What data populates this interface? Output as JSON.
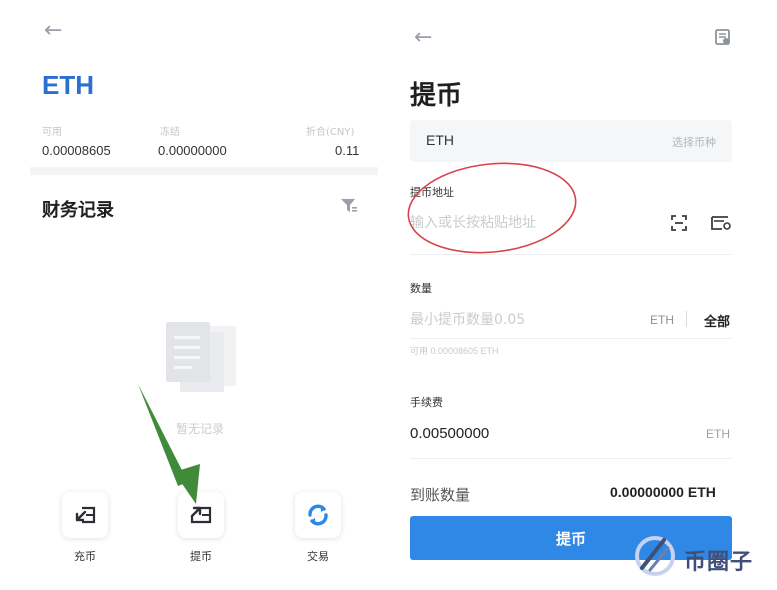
{
  "left": {
    "coin": "ETH",
    "stats": [
      {
        "label": "可用",
        "value": "0.00008605"
      },
      {
        "label": "冻结",
        "value": "0.00000000"
      },
      {
        "label": "折合(CNY)",
        "value": "0.11"
      }
    ],
    "records_title": "财务记录",
    "empty_text": "暂无记录",
    "actions": [
      {
        "label": "充币",
        "icon": "deposit-icon"
      },
      {
        "label": "提币",
        "icon": "withdraw-icon"
      },
      {
        "label": "交易",
        "icon": "trade-icon"
      }
    ]
  },
  "right": {
    "title": "提币",
    "coin": "ETH",
    "choose_coin": "选择币种",
    "address_label": "提币地址",
    "address_placeholder": "输入或长按粘贴地址",
    "amount_label": "数量",
    "amount_placeholder": "最小提币数量0.05",
    "amount_unit": "ETH",
    "amount_all": "全部",
    "available": "可用 0.00008605 ETH",
    "fee_label": "手续费",
    "fee_value": "0.00500000",
    "fee_unit": "ETH",
    "received_label": "到账数量",
    "received_value": "0.00000000 ETH",
    "submit_label": "提币"
  },
  "watermark": {
    "text": "币圈子"
  },
  "colors": {
    "accent": "#2f87e6",
    "coin_title": "#2b6fd1",
    "annotation_arrow": "#3f8b3a",
    "annotation_ellipse": "#d9434a"
  }
}
